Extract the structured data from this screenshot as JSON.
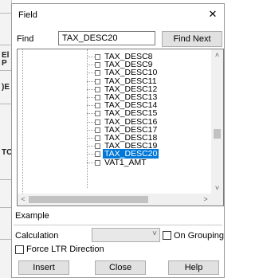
{
  "background_app": {
    "labels": [
      "El",
      "P",
      ")E",
      "TC"
    ]
  },
  "dialog": {
    "title": "Field",
    "close_glyph": "✕"
  },
  "find": {
    "label": "Find",
    "value": "TAX_DESC20",
    "find_next_label": "Find Next"
  },
  "tree": {
    "items": [
      "TAX_DESC8",
      "TAX_DESC9",
      "TAX_DESC10",
      "TAX_DESC11",
      "TAX_DESC12",
      "TAX_DESC13",
      "TAX_DESC14",
      "TAX_DESC15",
      "TAX_DESC16",
      "TAX_DESC17",
      "TAX_DESC18",
      "TAX_DESC19",
      "TAX_DESC20",
      "VAT1_AMT"
    ],
    "selected": "TAX_DESC20",
    "scroll_up": "˄",
    "scroll_down": "˅",
    "scroll_left": "<",
    "scroll_right": ">"
  },
  "example": {
    "label": "Example"
  },
  "calculation": {
    "label": "Calculation",
    "selected_value": "",
    "chevron": "˅"
  },
  "options": {
    "on_grouping_label": "On Grouping",
    "on_grouping_checked": false,
    "force_ltr_label": "Force LTR Direction",
    "force_ltr_checked": false
  },
  "buttons": {
    "insert": "Insert",
    "close": "Close",
    "help": "Help"
  },
  "colors": {
    "selection": "#0078d7",
    "button_face": "#e1e1e1"
  }
}
